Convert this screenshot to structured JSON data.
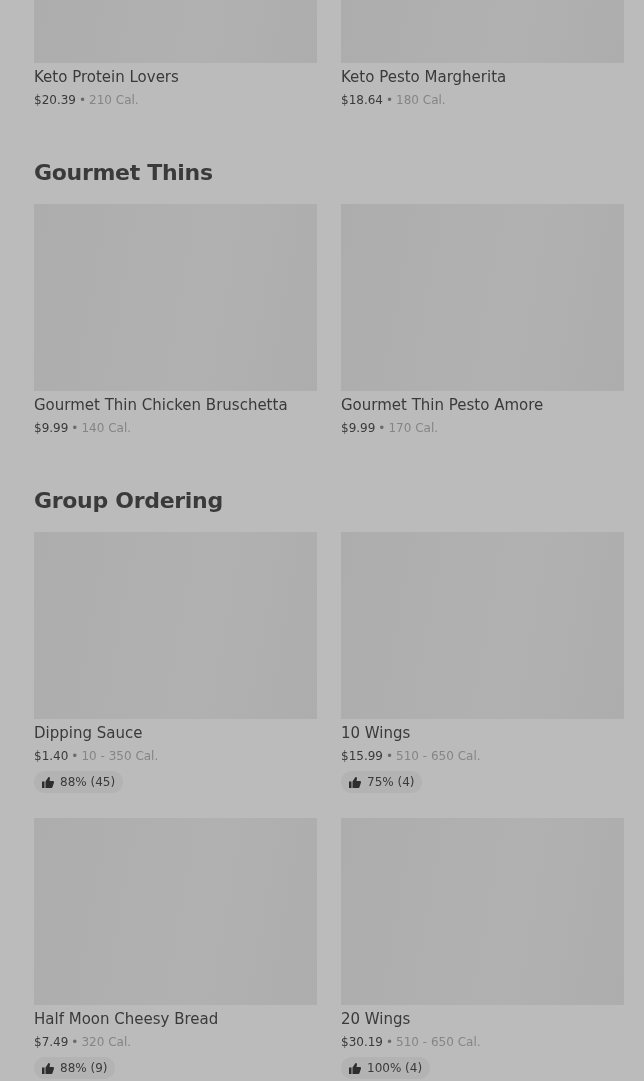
{
  "sections": [
    {
      "items": [
        {
          "name": "Keto Protein Lovers",
          "price": "$20.39",
          "separator": "•",
          "calories": "210 Cal."
        },
        {
          "name": "Keto Pesto Margherita",
          "price": "$18.64",
          "separator": "•",
          "calories": "180 Cal."
        }
      ]
    },
    {
      "title": "Gourmet Thins",
      "items": [
        {
          "name": "Gourmet Thin Chicken Bruschetta",
          "price": "$9.99",
          "separator": "•",
          "calories": "140 Cal."
        },
        {
          "name": "Gourmet Thin Pesto Amore",
          "price": "$9.99",
          "separator": "•",
          "calories": "170 Cal."
        }
      ]
    },
    {
      "title": "Group Ordering",
      "items": [
        {
          "name": "Dipping Sauce",
          "price": "$1.40",
          "separator": "•",
          "calories": "10 - 350 Cal.",
          "rating": "88% (45)"
        },
        {
          "name": "10 Wings",
          "price": "$15.99",
          "separator": "•",
          "calories": "510 - 650 Cal.",
          "rating": "75% (4)"
        },
        {
          "name": "Half Moon Cheesy Bread",
          "price": "$7.49",
          "separator": "•",
          "calories": "320 Cal.",
          "rating": "88% (9)"
        },
        {
          "name": "20 Wings",
          "price": "$30.19",
          "separator": "•",
          "calories": "510 - 650 Cal.",
          "rating": "100% (4)"
        }
      ]
    }
  ]
}
